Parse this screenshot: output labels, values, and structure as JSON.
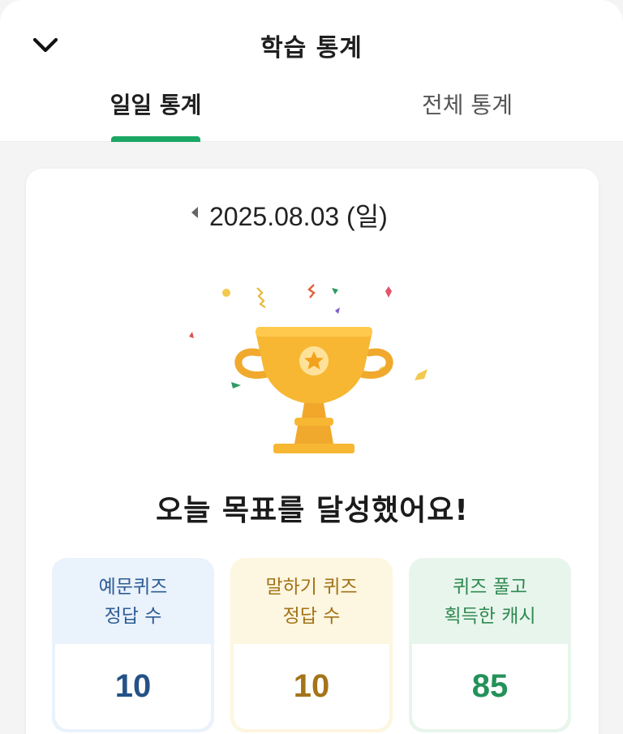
{
  "header": {
    "title": "학습 통계",
    "back_icon": "chevron-down-icon"
  },
  "tabs": [
    {
      "label": "일일 통계",
      "active": true
    },
    {
      "label": "전체 통계",
      "active": false
    }
  ],
  "accent_color": "#1aa763",
  "date": {
    "prev_icon": "caret-left-icon",
    "text": "2025.08.03 (일)"
  },
  "trophy_icon": "trophy-icon",
  "goal_message": "오늘 목표를 달성했어요!",
  "stats": [
    {
      "line1": "예문퀴즈",
      "line2": "정답 수",
      "value": "10",
      "color": "#245287"
    },
    {
      "line1": "말하기 퀴즈",
      "line2": "정답 수",
      "value": "10",
      "color": "#a4741a"
    },
    {
      "line1": "퀴즈 풀고",
      "line2": "획득한 캐시",
      "value": "85",
      "color": "#239259"
    }
  ]
}
